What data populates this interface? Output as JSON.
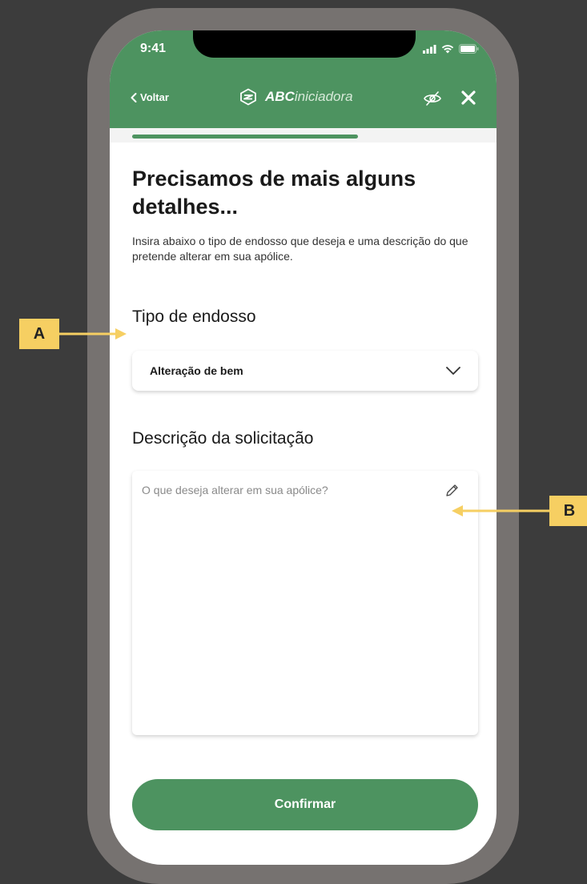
{
  "status_bar": {
    "time": "9:41"
  },
  "nav": {
    "back_label": "Voltar",
    "brand_bold": "ABC",
    "brand_light": "iniciadora"
  },
  "progress": {
    "fraction": 0.66
  },
  "main": {
    "title": "Precisamos de mais alguns detalhes...",
    "subtitle": "Insira abaixo o tipo de endosso que deseja e uma descrição do que pretende alterar em sua apólice."
  },
  "form": {
    "tipo_label": "Tipo de endosso",
    "tipo_value": "Alteração de bem",
    "descricao_label": "Descrição da solicitação",
    "descricao_placeholder": "O que deseja alterar em sua apólice?",
    "confirm_label": "Confirmar"
  },
  "annotations": {
    "a_label": "A",
    "b_label": "B"
  },
  "colors": {
    "brand_green": "#4d9360",
    "callout_yellow": "#f6cf62",
    "background": "#3c3c3c",
    "frame": "#767270"
  },
  "icons": [
    "signal-icon",
    "wifi-icon",
    "battery-icon",
    "chevron-left-icon",
    "logo-icon",
    "eye-off-icon",
    "close-icon",
    "chevron-down-icon",
    "pencil-icon"
  ]
}
